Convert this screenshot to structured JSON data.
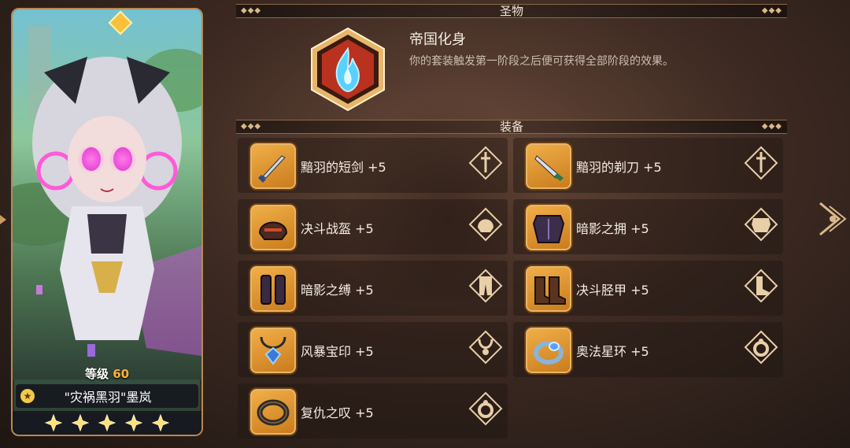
{
  "hero": {
    "level_label": "等级",
    "level": "60",
    "name": "\"灾祸黑羽\"墨岚",
    "stars": 5
  },
  "relic_section": {
    "title": "圣物",
    "relic_name": "帝国化身",
    "relic_desc": "你的套装触发第一阶段之后便可获得全部阶段的效果。",
    "relic_icon": "blue-flame-hexagon-icon"
  },
  "equip_section": {
    "title": "装备",
    "items": [
      {
        "name": "黯羽的短剑 +5",
        "icon": "dagger-icon",
        "slot_icon": "sword-slot-icon"
      },
      {
        "name": "黯羽的剃刀 +5",
        "icon": "razor-icon",
        "slot_icon": "sword-slot-icon"
      },
      {
        "name": "决斗战盔 +5",
        "icon": "helmet-icon",
        "slot_icon": "helmet-slot-icon"
      },
      {
        "name": "暗影之拥 +5",
        "icon": "armor-icon",
        "slot_icon": "armor-slot-icon"
      },
      {
        "name": "暗影之缚 +5",
        "icon": "leg-guards-icon",
        "slot_icon": "pants-slot-icon"
      },
      {
        "name": "决斗胫甲 +5",
        "icon": "boots-icon",
        "slot_icon": "boots-slot-icon"
      },
      {
        "name": "风暴宝印 +5",
        "icon": "amulet-icon",
        "slot_icon": "necklace-slot-icon"
      },
      {
        "name": "奥法星环 +5",
        "icon": "ring-icon",
        "slot_icon": "ring-slot-icon"
      },
      {
        "name": "复仇之叹 +5",
        "icon": "dark-ring-icon",
        "slot_icon": "ring-slot-icon"
      }
    ]
  },
  "colors": {
    "accent_gold": "#e7b66a",
    "level_orange": "#ffb13b",
    "relic_red": "#b8321f"
  }
}
